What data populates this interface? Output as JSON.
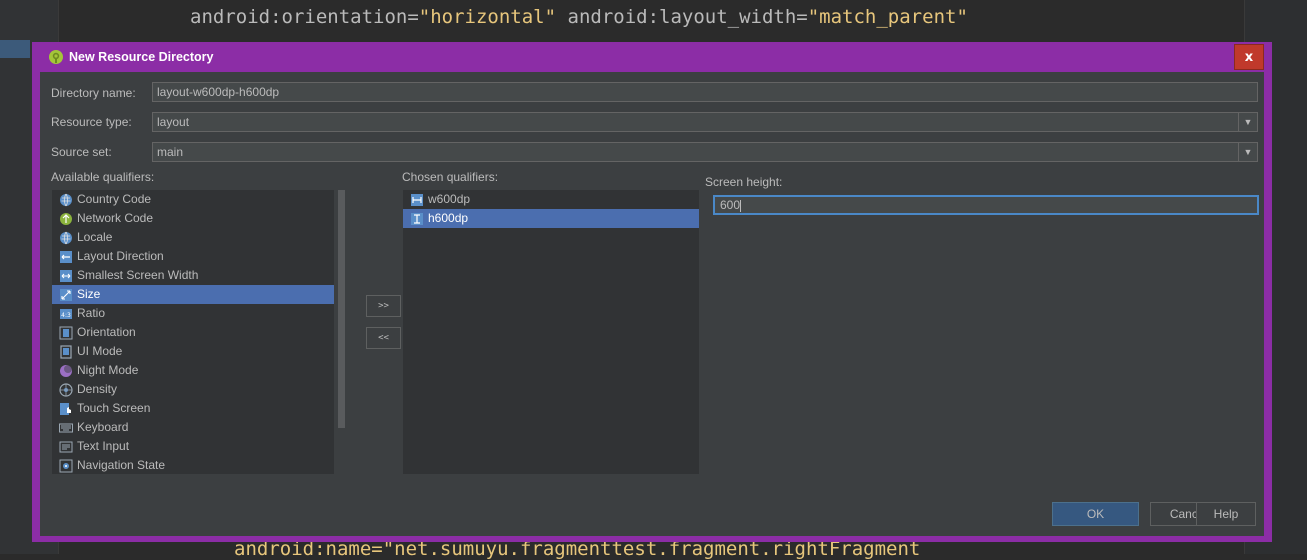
{
  "editor": {
    "line_top": {
      "attr1": "android:orientation=",
      "val1": "\"horizontal\"",
      "attr2": " android:layout_width=",
      "val2": "\"match_parent\""
    },
    "line_bottom": {
      "attr": "android:name=",
      "val": "\"net.sumuyu.fragmenttest.fragment.rightFragment"
    }
  },
  "dialog": {
    "title": "New Resource Directory",
    "close_label": "x",
    "directory_name": {
      "label": "Directory name:",
      "value": "layout-w600dp-h600dp"
    },
    "resource_type": {
      "label": "Resource type:",
      "value": "layout"
    },
    "source_set": {
      "label": "Source set:",
      "value": "main"
    },
    "available": {
      "label": "Available qualifiers:",
      "items": [
        {
          "label": "Country Code",
          "icon": "globe-icon"
        },
        {
          "label": "Network Code",
          "icon": "network-icon"
        },
        {
          "label": "Locale",
          "icon": "globe-icon"
        },
        {
          "label": "Layout Direction",
          "icon": "direction-icon"
        },
        {
          "label": "Smallest Screen Width",
          "icon": "screen-width-icon"
        },
        {
          "label": "Size",
          "icon": "size-icon",
          "selected": true
        },
        {
          "label": "Ratio",
          "icon": "ratio-icon"
        },
        {
          "label": "Orientation",
          "icon": "orientation-icon"
        },
        {
          "label": "UI Mode",
          "icon": "ui-mode-icon"
        },
        {
          "label": "Night Mode",
          "icon": "night-mode-icon"
        },
        {
          "label": "Density",
          "icon": "density-icon"
        },
        {
          "label": "Touch Screen",
          "icon": "touch-icon"
        },
        {
          "label": "Keyboard",
          "icon": "keyboard-icon"
        },
        {
          "label": "Text Input",
          "icon": "text-input-icon"
        },
        {
          "label": "Navigation State",
          "icon": "navigation-icon"
        }
      ]
    },
    "move_right_label": ">>",
    "move_left_label": "<<",
    "chosen": {
      "label": "Chosen qualifiers:",
      "items": [
        {
          "label": "w600dp",
          "icon": "width-icon"
        },
        {
          "label": "h600dp",
          "icon": "height-icon",
          "selected": true
        }
      ]
    },
    "screen_height": {
      "label": "Screen height:",
      "value": "600"
    },
    "buttons": {
      "ok": "OK",
      "cancel": "Cancel",
      "help": "Help"
    },
    "colors": {
      "frame": "#8c2da6",
      "body": "#3c3f41",
      "selection": "#4b6eaf",
      "close": "#c0392b",
      "focus": "#4a88c7"
    }
  }
}
